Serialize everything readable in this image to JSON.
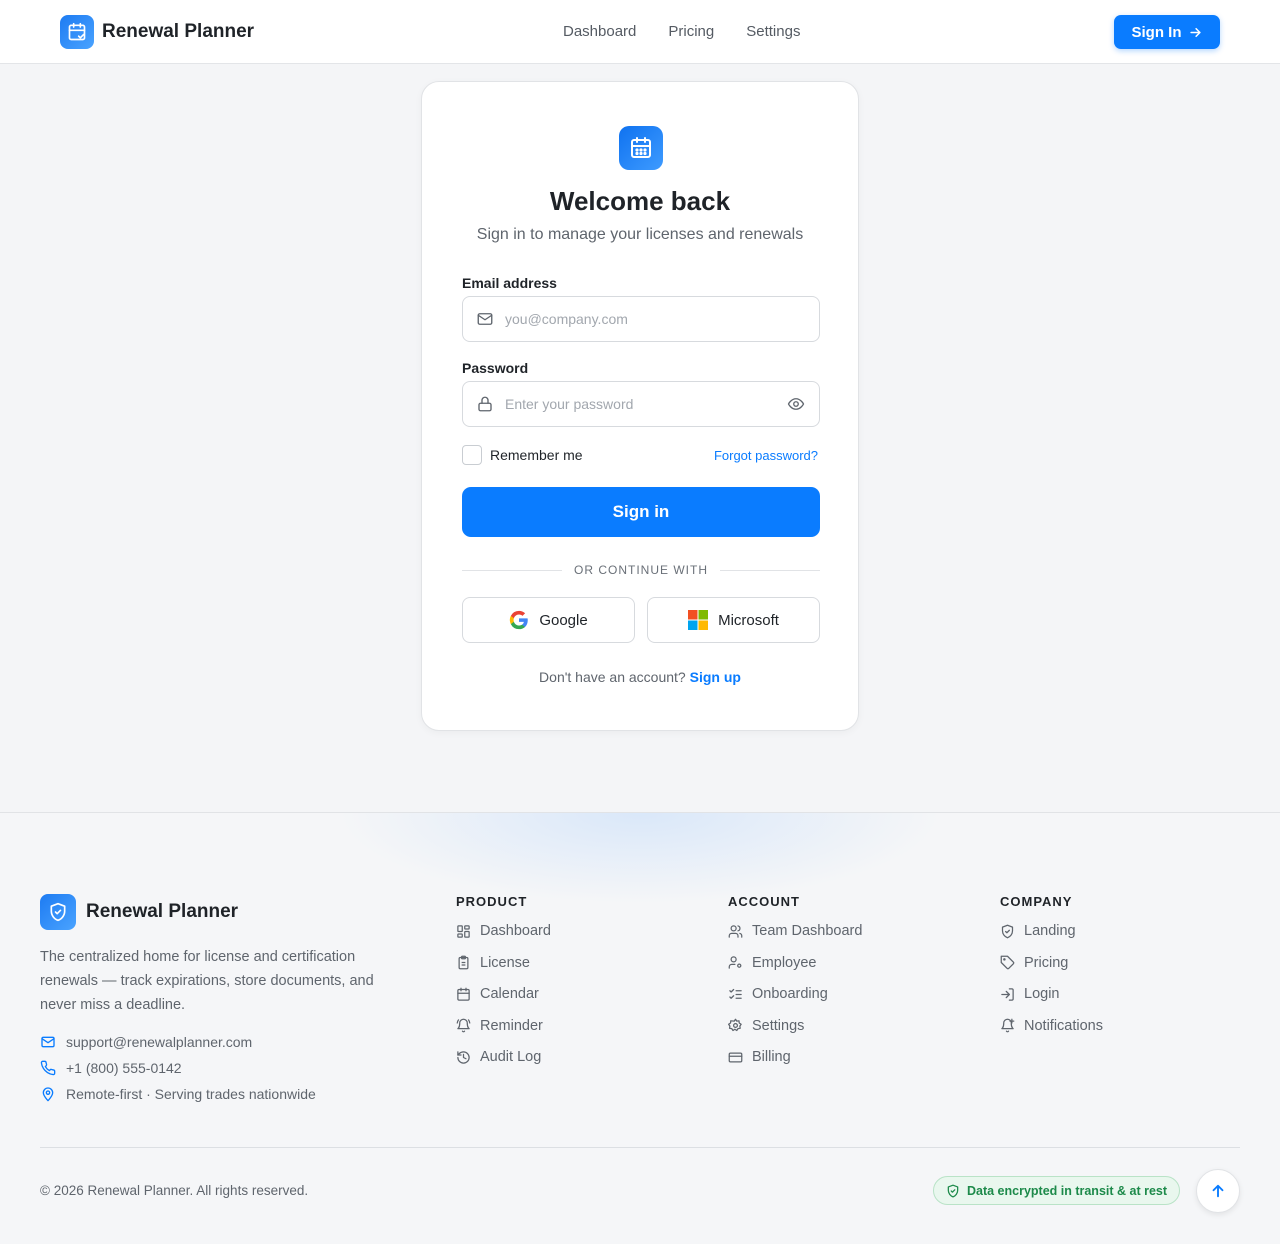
{
  "header": {
    "brand_name": "Renewal Planner",
    "nav": [
      "Dashboard",
      "Pricing",
      "Settings"
    ],
    "signin_label": "Sign In"
  },
  "login": {
    "title": "Welcome back",
    "subtitle": "Sign in to manage your licenses and renewals",
    "email_label": "Email address",
    "email_placeholder": "you@company.com",
    "email_value": "",
    "password_label": "Password",
    "password_placeholder": "Enter your password",
    "password_value": "",
    "remember_label": "Remember me",
    "remember_checked": false,
    "forgot_label": "Forgot password?",
    "submit_label": "Sign in",
    "divider_text": "OR CONTINUE WITH",
    "google_label": "Google",
    "microsoft_label": "Microsoft",
    "no_account_text": "Don't have an account?",
    "signup_label": "Sign up"
  },
  "footer": {
    "brand_name": "Renewal Planner",
    "description": "The centralized home for license and certification renewals — track expirations, store documents, and never miss a deadline.",
    "email": "support@renewalplanner.com",
    "phone": "+1 (800) 555-0142",
    "location": "Remote-first · Serving trades nationwide",
    "columns": [
      {
        "title": "PRODUCT",
        "items": [
          {
            "label": "Dashboard",
            "icon": "grid-icon"
          },
          {
            "label": "License",
            "icon": "clipboard-icon"
          },
          {
            "label": "Calendar",
            "icon": "calendar-icon"
          },
          {
            "label": "Reminder",
            "icon": "bell-ring-icon"
          },
          {
            "label": "Audit Log",
            "icon": "history-icon"
          }
        ]
      },
      {
        "title": "ACCOUNT",
        "items": [
          {
            "label": "Team Dashboard",
            "icon": "users-icon"
          },
          {
            "label": "Employee",
            "icon": "user-cog-icon"
          },
          {
            "label": "Onboarding",
            "icon": "list-checks-icon"
          },
          {
            "label": "Settings",
            "icon": "gear-icon"
          },
          {
            "label": "Billing",
            "icon": "credit-card-icon"
          }
        ]
      },
      {
        "title": "COMPANY",
        "items": [
          {
            "label": "Landing",
            "icon": "shield-check-icon"
          },
          {
            "label": "Pricing",
            "icon": "tag-icon"
          },
          {
            "label": "Login",
            "icon": "log-in-icon"
          },
          {
            "label": "Notifications",
            "icon": "bell-plus-icon"
          }
        ]
      }
    ],
    "copyright": "© 2026 Renewal Planner. All rights reserved.",
    "badge": "Data encrypted in transit & at rest"
  },
  "colors": {
    "accent": "#0a7cff",
    "success": "#1d8a4a",
    "background": "#f4f5f7"
  }
}
